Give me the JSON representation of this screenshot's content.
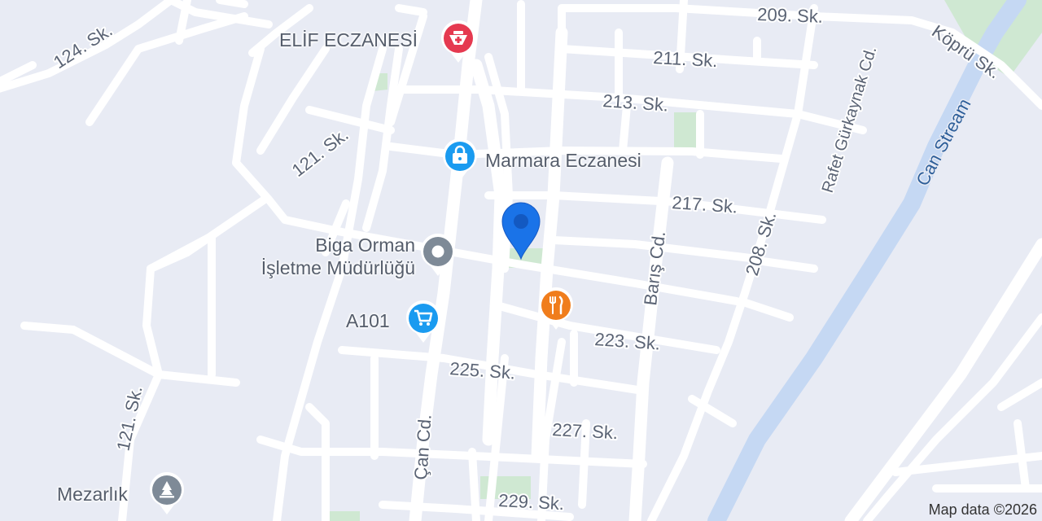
{
  "map": {
    "streets": [
      {
        "id": "s124",
        "label": "124. Sk."
      },
      {
        "id": "s121a",
        "label": "121. Sk."
      },
      {
        "id": "s121b",
        "label": "121. Sk."
      },
      {
        "id": "s209",
        "label": "209. Sk."
      },
      {
        "id": "s211",
        "label": "211. Sk."
      },
      {
        "id": "s213",
        "label": "213. Sk."
      },
      {
        "id": "s217",
        "label": "217. Sk."
      },
      {
        "id": "s223",
        "label": "223. Sk."
      },
      {
        "id": "s225",
        "label": "225. Sk."
      },
      {
        "id": "s227",
        "label": "227. Sk."
      },
      {
        "id": "s229",
        "label": "229. Sk."
      },
      {
        "id": "s208",
        "label": "208. Sk."
      },
      {
        "id": "kopru",
        "label": "Köprü Sk."
      },
      {
        "id": "rafet",
        "label": "Rafet Gürkaynak Cd."
      },
      {
        "id": "baris",
        "label": "Barış Cd."
      },
      {
        "id": "can",
        "label": "Çan Cd."
      }
    ],
    "water": {
      "label": "Can Stream"
    },
    "pois": [
      {
        "id": "elif",
        "label": "ELİF ECZANESİ",
        "icon": "pharmacy-icon",
        "color": "#e53950"
      },
      {
        "id": "marmara",
        "label": "Marmara Eczanesi",
        "icon": "shopping-bag-icon",
        "color": "#1a9bf0"
      },
      {
        "id": "biga",
        "label_line1": "Biga Orman",
        "label_line2": "İşletme Müdürlüğü",
        "icon": "government-building-icon",
        "color": "#7e8a97"
      },
      {
        "id": "a101",
        "label": "A101",
        "icon": "shopping-cart-icon",
        "color": "#1a9bf0"
      },
      {
        "id": "restaurant",
        "label": "",
        "icon": "restaurant-icon",
        "color": "#f07d1c"
      },
      {
        "id": "mezarlik",
        "label": "Mezarlık",
        "icon": "cemetery-icon",
        "color": "#7e8a97"
      }
    ],
    "location_marker": {
      "icon": "location-pin-icon",
      "color": "#1a73e8"
    },
    "attribution": "Map data ©2026"
  }
}
